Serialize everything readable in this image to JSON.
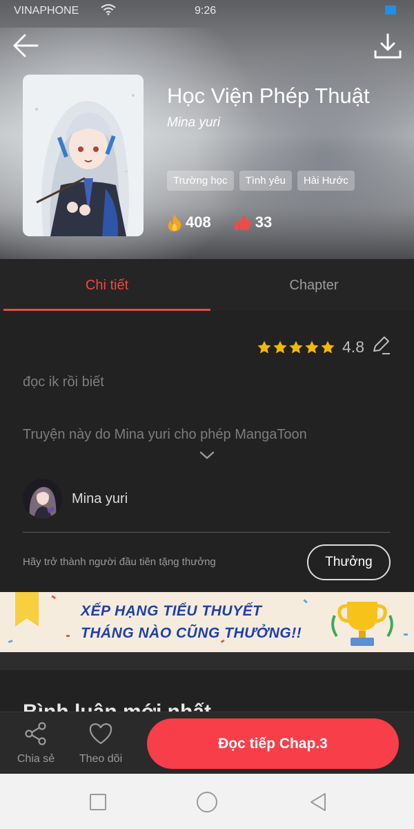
{
  "status_bar": {
    "carrier": "VINAPHONE",
    "time": "9:26"
  },
  "book": {
    "title": "Học Viện Phép Thuật",
    "author": "Mina yuri",
    "tags": [
      "Trường học",
      "Tình yêu",
      "Hài Hước"
    ],
    "views": "408",
    "likes": "33"
  },
  "tabs": {
    "detail": "Chi tiết",
    "chapter": "Chapter"
  },
  "rating": {
    "value": "4.8",
    "stars": 5
  },
  "description": "đọc ik rồi biết",
  "permission": "Truyện này do Mina yuri cho phép MangaToon",
  "author_row": {
    "name": "Mina yuri"
  },
  "reward": {
    "text": "Hãy trở thành người đầu tiên tặng thưởng",
    "button": "Thưởng"
  },
  "banner": {
    "line1": "XẾP HẠNG TIỂU THUYẾT",
    "line2": "THÁNG NÀO CŨNG THƯỞNG!!"
  },
  "section_peek": "Bình luận mới nhất",
  "bottom_bar": {
    "share": "Chia sẻ",
    "follow": "Theo dõi",
    "read": "Đọc tiếp Chap.3"
  },
  "colors": {
    "accent": "#f73e49",
    "tab_active": "#f2473f",
    "star": "#f5b800"
  },
  "icons": [
    "back-arrow-icon",
    "download-icon",
    "fire-icon",
    "thumbs-up-icon",
    "star-icon",
    "edit-icon",
    "chevron-down-icon",
    "share-icon",
    "heart-icon",
    "square-nav-icon",
    "circle-nav-icon",
    "triangle-back-nav-icon"
  ]
}
